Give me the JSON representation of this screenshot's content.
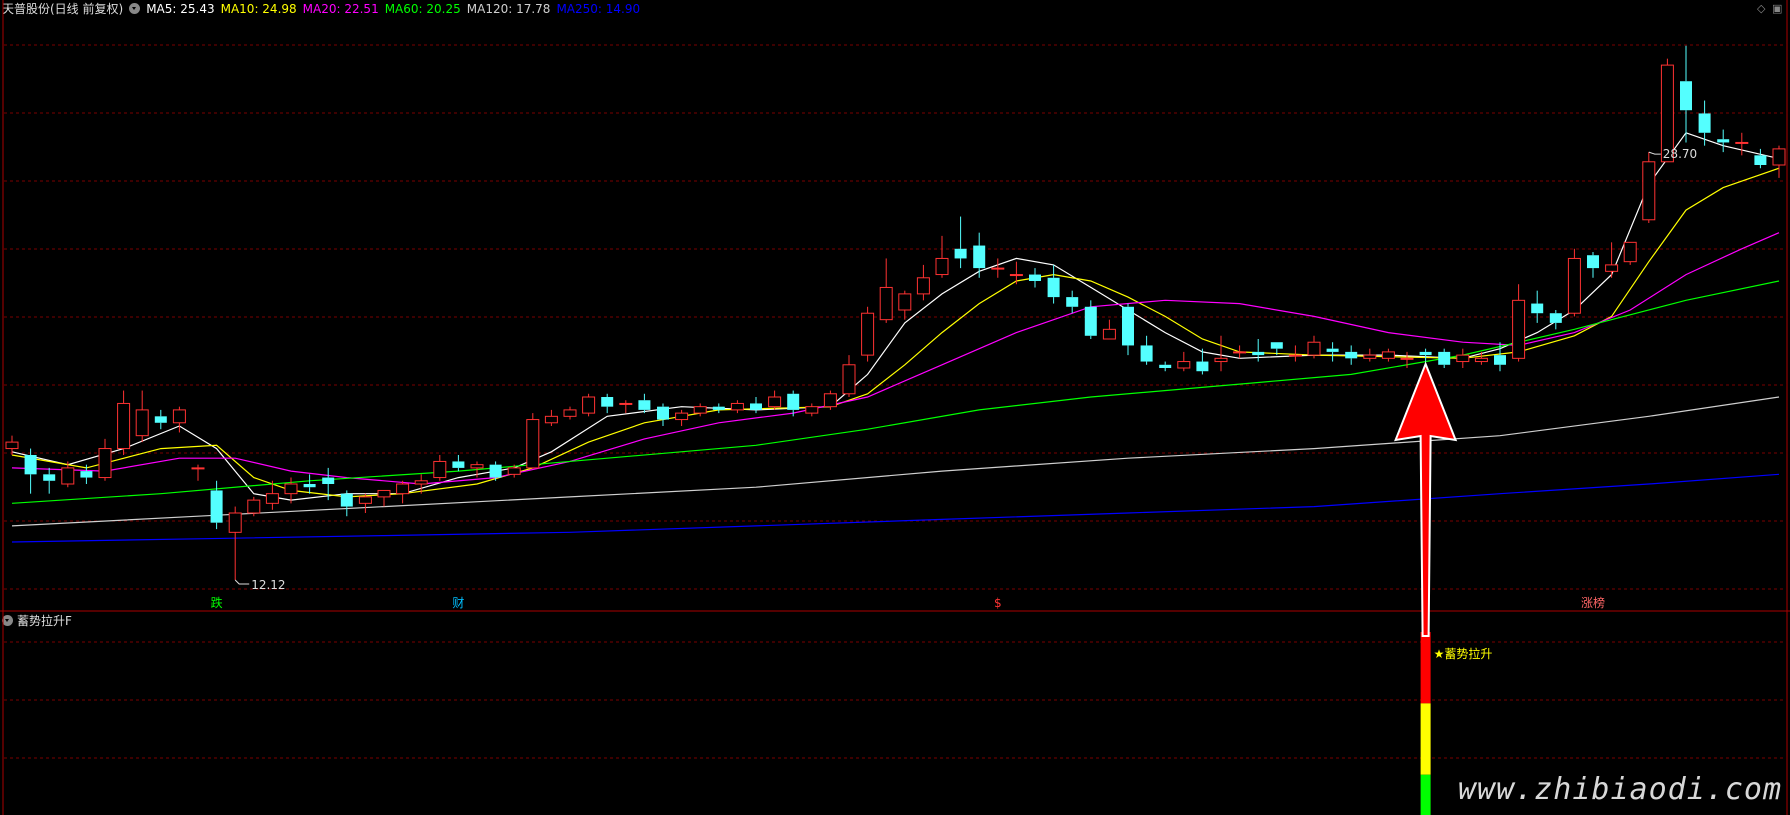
{
  "header": {
    "stock": "天普股份(日线 前复权)",
    "ma": [
      {
        "label": "MA5: 25.43",
        "color": "#ffffff"
      },
      {
        "label": "MA10: 24.98",
        "color": "#ffff00"
      },
      {
        "label": "MA20: 22.51",
        "color": "#ff00ff"
      },
      {
        "label": "MA60: 20.25",
        "color": "#00ff00"
      },
      {
        "label": "MA120: 17.78",
        "color": "#cfcfcf"
      },
      {
        "label": "MA250: 14.90",
        "color": "#0000ff"
      }
    ]
  },
  "indicator": {
    "name": "蓄势拉升F",
    "signal_label": "★蓄势拉升"
  },
  "corner_icons": [
    "diamond-icon",
    "panel-icon"
  ],
  "watermark": "www.zhibiaodi.com",
  "chart_data": {
    "type": "candlestick",
    "y_range": [
      11.5,
      29.5
    ],
    "high_label": "28.70",
    "low_label": "12.12",
    "high_index": 88,
    "low_index": 12,
    "signal_index": 76,
    "markers": [
      {
        "index": 11,
        "text": "跌",
        "color": "#00ff00"
      },
      {
        "index": 24,
        "text": "财",
        "color": "#00bfff"
      },
      {
        "index": 53,
        "text": "$",
        "color": "#ff3333"
      },
      {
        "index": 85,
        "text": "涨榜",
        "color": "#ff6666"
      }
    ],
    "candles": [
      [
        16.2,
        16.4,
        16.6,
        16.0
      ],
      [
        16.0,
        15.4,
        16.2,
        14.8
      ],
      [
        15.4,
        15.2,
        15.6,
        14.8
      ],
      [
        15.1,
        15.6,
        15.8,
        15.0
      ],
      [
        15.5,
        15.3,
        15.7,
        15.1
      ],
      [
        15.3,
        16.2,
        16.5,
        15.2
      ],
      [
        16.2,
        17.6,
        18.0,
        16.0
      ],
      [
        16.6,
        17.4,
        18.0,
        16.4
      ],
      [
        17.2,
        17.0,
        17.4,
        16.8
      ],
      [
        17.0,
        17.4,
        17.5,
        16.7
      ],
      [
        15.6,
        15.6,
        15.7,
        15.2
      ],
      [
        14.9,
        13.9,
        15.2,
        13.7
      ],
      [
        13.6,
        14.2,
        14.4,
        12.12
      ],
      [
        14.2,
        14.6,
        14.7,
        14.1
      ],
      [
        14.5,
        14.8,
        15.2,
        14.3
      ],
      [
        14.8,
        15.1,
        15.3,
        14.5
      ],
      [
        15.1,
        15.0,
        15.4,
        14.8
      ],
      [
        15.3,
        15.1,
        15.6,
        14.6
      ],
      [
        14.8,
        14.4,
        14.9,
        14.1
      ],
      [
        14.5,
        14.7,
        14.8,
        14.2
      ],
      [
        14.7,
        14.9,
        14.9,
        14.4
      ],
      [
        14.8,
        15.1,
        15.2,
        14.5
      ],
      [
        15.1,
        15.2,
        15.4,
        14.8
      ],
      [
        15.3,
        15.8,
        16.0,
        15.2
      ],
      [
        15.8,
        15.6,
        16.0,
        15.5
      ],
      [
        15.6,
        15.7,
        15.8,
        15.3
      ],
      [
        15.7,
        15.3,
        15.8,
        15.2
      ],
      [
        15.4,
        15.6,
        15.7,
        15.3
      ],
      [
        15.6,
        17.1,
        17.3,
        15.6
      ],
      [
        17.0,
        17.2,
        17.4,
        16.9
      ],
      [
        17.2,
        17.4,
        17.5,
        17.1
      ],
      [
        17.3,
        17.8,
        17.9,
        17.2
      ],
      [
        17.8,
        17.5,
        17.9,
        17.3
      ],
      [
        17.6,
        17.6,
        17.7,
        17.3
      ],
      [
        17.7,
        17.4,
        17.9,
        17.3
      ],
      [
        17.5,
        17.1,
        17.6,
        16.9
      ],
      [
        17.1,
        17.3,
        17.4,
        16.9
      ],
      [
        17.3,
        17.5,
        17.6,
        17.2
      ],
      [
        17.5,
        17.4,
        17.6,
        17.3
      ],
      [
        17.4,
        17.6,
        17.7,
        17.3
      ],
      [
        17.6,
        17.4,
        17.8,
        17.3
      ],
      [
        17.5,
        17.8,
        18.0,
        17.4
      ],
      [
        17.9,
        17.4,
        18.0,
        17.2
      ],
      [
        17.3,
        17.5,
        17.6,
        17.2
      ],
      [
        17.5,
        17.9,
        18.0,
        17.4
      ],
      [
        17.9,
        18.8,
        19.1,
        17.8
      ],
      [
        19.1,
        20.4,
        20.6,
        18.9
      ],
      [
        20.2,
        21.2,
        22.1,
        20.1
      ],
      [
        20.5,
        21.0,
        21.1,
        20.2
      ],
      [
        21.0,
        21.5,
        21.9,
        20.8
      ],
      [
        21.6,
        22.1,
        22.8,
        21.5
      ],
      [
        22.4,
        22.1,
        23.4,
        21.8
      ],
      [
        22.5,
        21.8,
        22.9,
        21.5
      ],
      [
        21.8,
        21.8,
        22.1,
        21.5
      ],
      [
        21.6,
        21.6,
        22.0,
        21.3
      ],
      [
        21.6,
        21.4,
        21.8,
        21.2
      ],
      [
        21.5,
        20.9,
        21.9,
        20.7
      ],
      [
        20.9,
        20.6,
        21.1,
        20.4
      ],
      [
        20.6,
        19.7,
        20.8,
        19.6
      ],
      [
        19.6,
        19.9,
        20.2,
        19.6
      ],
      [
        20.6,
        19.4,
        20.7,
        19.1
      ],
      [
        19.4,
        18.9,
        19.7,
        18.8
      ],
      [
        18.8,
        18.7,
        18.9,
        18.6
      ],
      [
        18.7,
        18.9,
        19.2,
        18.6
      ],
      [
        18.9,
        18.6,
        19.3,
        18.5
      ],
      [
        18.9,
        19.0,
        19.7,
        18.6
      ],
      [
        19.2,
        19.2,
        19.4,
        19.0
      ],
      [
        19.2,
        19.1,
        19.6,
        18.9
      ],
      [
        19.5,
        19.3,
        19.5,
        19.1
      ],
      [
        19.1,
        19.1,
        19.4,
        18.9
      ],
      [
        19.1,
        19.5,
        19.7,
        19.0
      ],
      [
        19.3,
        19.2,
        19.5,
        18.9
      ],
      [
        19.2,
        19.0,
        19.4,
        18.8
      ],
      [
        19.0,
        19.1,
        19.3,
        18.9
      ],
      [
        19.0,
        19.2,
        19.3,
        18.9
      ],
      [
        19.0,
        19.0,
        19.2,
        18.7
      ],
      [
        19.2,
        19.1,
        19.3,
        18.9
      ],
      [
        19.2,
        18.8,
        19.3,
        18.7
      ],
      [
        18.9,
        19.1,
        19.3,
        18.7
      ],
      [
        18.9,
        19.0,
        19.2,
        18.8
      ],
      [
        19.1,
        18.8,
        19.5,
        18.6
      ],
      [
        19.0,
        20.8,
        21.3,
        18.9
      ],
      [
        20.7,
        20.4,
        21.1,
        20.1
      ],
      [
        20.4,
        20.1,
        20.5,
        19.9
      ],
      [
        20.4,
        22.1,
        22.4,
        20.3
      ],
      [
        22.2,
        21.8,
        22.3,
        21.5
      ],
      [
        21.7,
        21.9,
        22.6,
        21.5
      ],
      [
        22.0,
        22.6,
        22.6,
        21.9
      ],
      [
        23.3,
        25.1,
        25.4,
        23.2
      ],
      [
        25.1,
        28.1,
        28.3,
        25.1
      ],
      [
        27.6,
        26.7,
        28.7,
        25.7
      ],
      [
        26.6,
        26.0,
        27.0,
        25.6
      ],
      [
        25.8,
        25.7,
        26.1,
        25.4
      ],
      [
        25.7,
        25.7,
        26.0,
        25.3
      ],
      [
        25.3,
        25.0,
        25.5,
        24.9
      ],
      [
        25.0,
        25.5,
        25.6,
        24.6
      ]
    ],
    "ma_series": [
      {
        "name": "MA5",
        "color": "#ffffff",
        "points": [
          [
            0,
            16.1
          ],
          [
            3,
            15.7
          ],
          [
            6,
            16.2
          ],
          [
            9,
            16.9
          ],
          [
            11,
            16.2
          ],
          [
            13,
            14.8
          ],
          [
            15,
            14.6
          ],
          [
            18,
            14.8
          ],
          [
            21,
            14.8
          ],
          [
            24,
            15.3
          ],
          [
            27,
            15.6
          ],
          [
            29,
            16.1
          ],
          [
            32,
            17.2
          ],
          [
            36,
            17.5
          ],
          [
            40,
            17.4
          ],
          [
            44,
            17.5
          ],
          [
            46,
            18.5
          ],
          [
            48,
            20.1
          ],
          [
            50,
            21.0
          ],
          [
            52,
            21.7
          ],
          [
            54,
            22.1
          ],
          [
            56,
            21.9
          ],
          [
            58,
            21.2
          ],
          [
            60,
            20.5
          ],
          [
            62,
            19.8
          ],
          [
            64,
            19.2
          ],
          [
            66,
            19.0
          ],
          [
            70,
            19.1
          ],
          [
            74,
            19.1
          ],
          [
            78,
            19.0
          ],
          [
            80,
            19.3
          ],
          [
            82,
            19.8
          ],
          [
            84,
            20.5
          ],
          [
            86,
            21.6
          ],
          [
            88,
            24.4
          ],
          [
            90,
            26.0
          ],
          [
            92,
            25.6
          ],
          [
            95,
            25.2
          ]
        ]
      },
      {
        "name": "MA10",
        "color": "#ffff00",
        "points": [
          [
            0,
            16.0
          ],
          [
            4,
            15.6
          ],
          [
            8,
            16.2
          ],
          [
            11,
            16.3
          ],
          [
            13,
            15.3
          ],
          [
            15,
            14.9
          ],
          [
            18,
            14.7
          ],
          [
            21,
            14.8
          ],
          [
            25,
            15.1
          ],
          [
            28,
            15.6
          ],
          [
            31,
            16.4
          ],
          [
            34,
            17.0
          ],
          [
            38,
            17.4
          ],
          [
            44,
            17.5
          ],
          [
            46,
            17.9
          ],
          [
            48,
            18.8
          ],
          [
            50,
            19.8
          ],
          [
            52,
            20.7
          ],
          [
            54,
            21.4
          ],
          [
            56,
            21.6
          ],
          [
            58,
            21.4
          ],
          [
            60,
            20.9
          ],
          [
            62,
            20.3
          ],
          [
            64,
            19.6
          ],
          [
            66,
            19.2
          ],
          [
            70,
            19.1
          ],
          [
            78,
            19.0
          ],
          [
            81,
            19.2
          ],
          [
            84,
            19.7
          ],
          [
            86,
            20.3
          ],
          [
            88,
            22.0
          ],
          [
            90,
            23.6
          ],
          [
            92,
            24.3
          ],
          [
            95,
            24.9
          ]
        ]
      },
      {
        "name": "MA20",
        "color": "#ff00ff",
        "points": [
          [
            0,
            15.6
          ],
          [
            5,
            15.5
          ],
          [
            9,
            15.9
          ],
          [
            12,
            15.9
          ],
          [
            15,
            15.5
          ],
          [
            18,
            15.3
          ],
          [
            22,
            15.1
          ],
          [
            26,
            15.3
          ],
          [
            30,
            15.8
          ],
          [
            34,
            16.5
          ],
          [
            38,
            17.0
          ],
          [
            42,
            17.3
          ],
          [
            46,
            17.8
          ],
          [
            50,
            18.8
          ],
          [
            54,
            19.8
          ],
          [
            58,
            20.6
          ],
          [
            62,
            20.8
          ],
          [
            66,
            20.7
          ],
          [
            70,
            20.3
          ],
          [
            74,
            19.8
          ],
          [
            78,
            19.5
          ],
          [
            81,
            19.4
          ],
          [
            84,
            19.8
          ],
          [
            87,
            20.5
          ],
          [
            90,
            21.6
          ],
          [
            93,
            22.4
          ],
          [
            95,
            22.9
          ]
        ]
      },
      {
        "name": "MA60",
        "color": "#00ff00",
        "points": [
          [
            0,
            14.5
          ],
          [
            8,
            14.8
          ],
          [
            16,
            15.2
          ],
          [
            24,
            15.5
          ],
          [
            32,
            15.9
          ],
          [
            40,
            16.3
          ],
          [
            46,
            16.8
          ],
          [
            52,
            17.4
          ],
          [
            58,
            17.8
          ],
          [
            66,
            18.2
          ],
          [
            72,
            18.5
          ],
          [
            78,
            19.1
          ],
          [
            84,
            19.9
          ],
          [
            90,
            20.8
          ],
          [
            95,
            21.4
          ]
        ]
      },
      {
        "name": "MA120",
        "color": "#cfcfcf",
        "points": [
          [
            0,
            13.8
          ],
          [
            10,
            14.1
          ],
          [
            20,
            14.4
          ],
          [
            30,
            14.7
          ],
          [
            40,
            15.0
          ],
          [
            50,
            15.5
          ],
          [
            60,
            15.9
          ],
          [
            70,
            16.2
          ],
          [
            80,
            16.6
          ],
          [
            88,
            17.2
          ],
          [
            95,
            17.8
          ]
        ]
      },
      {
        "name": "MA250",
        "color": "#0000ff",
        "points": [
          [
            0,
            13.3
          ],
          [
            10,
            13.4
          ],
          [
            20,
            13.5
          ],
          [
            30,
            13.6
          ],
          [
            40,
            13.8
          ],
          [
            50,
            14.0
          ],
          [
            60,
            14.2
          ],
          [
            70,
            14.4
          ],
          [
            80,
            14.8
          ],
          [
            88,
            15.1
          ],
          [
            95,
            15.4
          ]
        ]
      }
    ],
    "signal_bar": [
      {
        "color": "#ff0000",
        "share": 0.39
      },
      {
        "color": "#ffff00",
        "share": 0.39
      },
      {
        "color": "#00ff00",
        "share": 0.22
      }
    ]
  }
}
